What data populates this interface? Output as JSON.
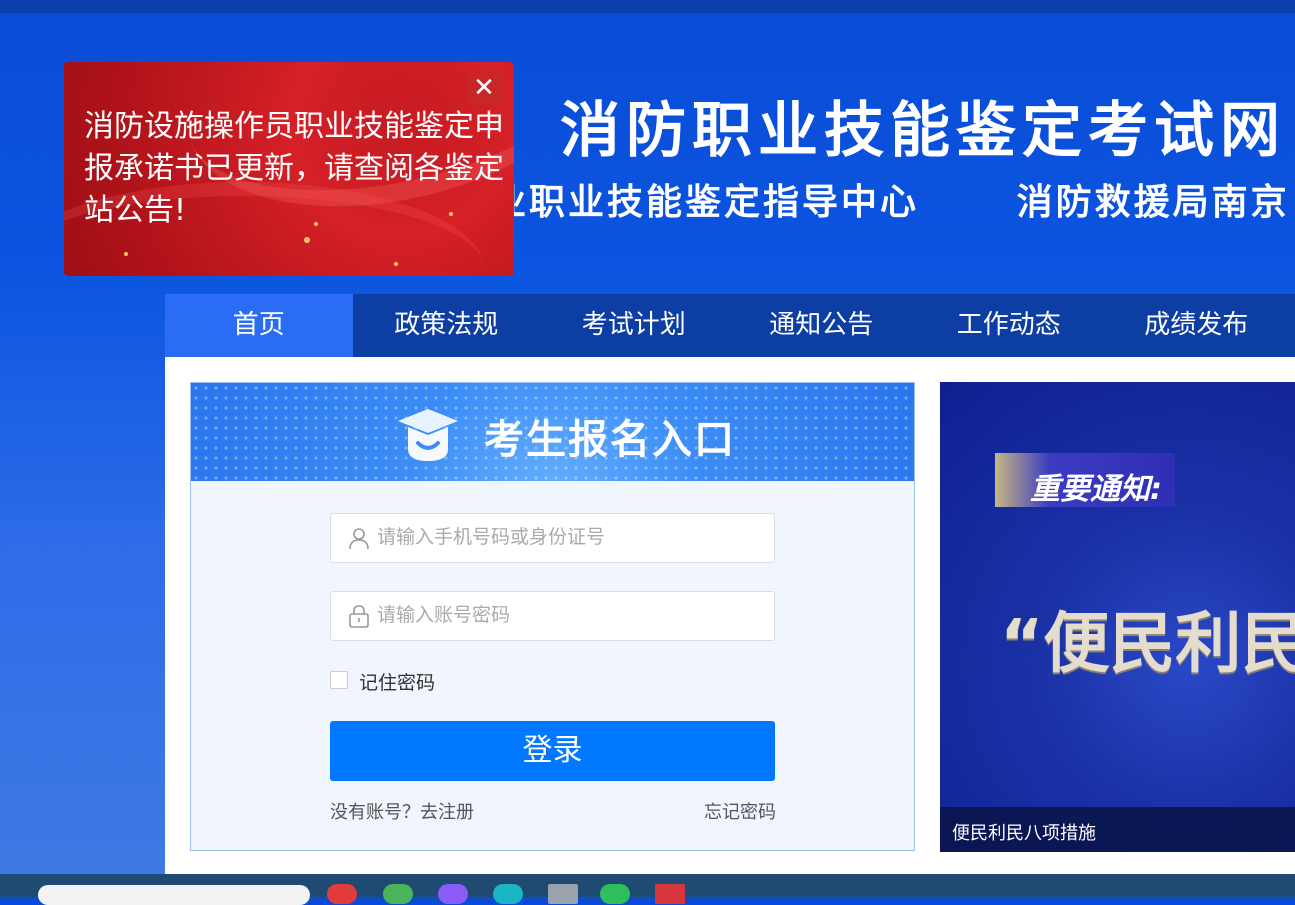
{
  "header": {
    "site_title": "消防职业技能鉴定考试网",
    "marquee_items": [
      "业职业技能鉴定指导中心",
      "消防救援局南京"
    ]
  },
  "popup": {
    "message": "消防设施操作员职业技能鉴定申报承诺书已更新，请查阅各鉴定站公告!",
    "close_symbol": "✕"
  },
  "nav": {
    "items": [
      {
        "label": "首页",
        "active": true
      },
      {
        "label": "政策法规",
        "active": false
      },
      {
        "label": "考试计划",
        "active": false
      },
      {
        "label": "通知公告",
        "active": false
      },
      {
        "label": "工作动态",
        "active": false
      },
      {
        "label": "成绩发布",
        "active": false
      }
    ]
  },
  "login": {
    "title": "考生报名入口",
    "username_placeholder": "请输入手机号码或身份证号",
    "password_placeholder": "请输入账号密码",
    "remember_label": "记住密码",
    "remember_checked": false,
    "submit_label": "登录",
    "register_link": "没有账号？去注册",
    "forgot_link": "忘记密码",
    "icons": {
      "user": "user-icon",
      "password": "lock-icon",
      "header": "graduation-cap-icon"
    }
  },
  "banner": {
    "notice_label": "重要通知:",
    "headline": "“便民利民",
    "caption": "便民利民八项措施"
  },
  "colors": {
    "page_bg": "#0b55e0",
    "nav_bg": "#0c3ea3",
    "nav_active": "#2a6df4",
    "login_button": "#0078ff",
    "popup_bg": "#c61b22"
  }
}
